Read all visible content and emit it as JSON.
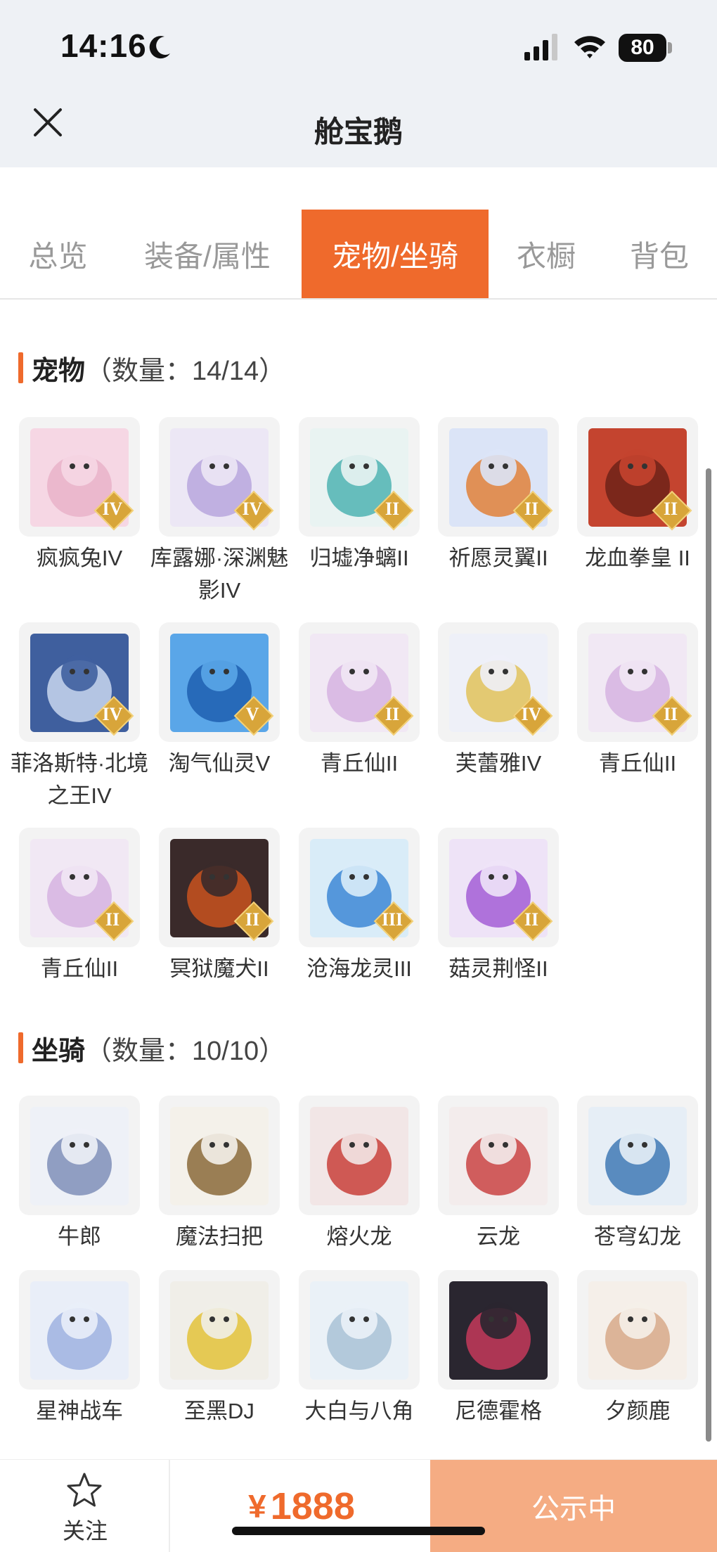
{
  "status_bar": {
    "time": "14:16",
    "battery": "80"
  },
  "nav": {
    "title": "舱宝鹅"
  },
  "tabs": [
    {
      "label": "总览",
      "active": false
    },
    {
      "label": "装备/属性",
      "active": false
    },
    {
      "label": "宠物/坐骑",
      "active": true
    },
    {
      "label": "衣橱",
      "active": false
    },
    {
      "label": "背包",
      "active": false
    }
  ],
  "pets": {
    "title": "宠物",
    "count": "（数量：14/14）",
    "items": [
      {
        "name": "疯疯兔IV",
        "rank": "IV",
        "icon": "pink-rabbit",
        "colors": [
          "#f6d7e4",
          "#e9b3c9"
        ]
      },
      {
        "name": "库露娜·深渊魅影IV",
        "rank": "IV",
        "icon": "white-haired-girl",
        "colors": [
          "#ece7f5",
          "#b8a6dd"
        ]
      },
      {
        "name": "归墟净螭II",
        "rank": "II",
        "icon": "jade-dragon",
        "colors": [
          "#e9f3f2",
          "#4fb3b3"
        ]
      },
      {
        "name": "祈愿灵翼II",
        "rank": "II",
        "icon": "winged-eagle",
        "colors": [
          "#dbe4f7",
          "#e0813a"
        ]
      },
      {
        "name": "龙血拳皇 II",
        "rank": "II",
        "icon": "red-dragon-boxer",
        "colors": [
          "#c4442f",
          "#6e2218"
        ]
      },
      {
        "name": "菲洛斯特·北境之王IV",
        "rank": "IV",
        "icon": "frost-wolf-king",
        "colors": [
          "#3f5f9e",
          "#c9d7ee"
        ]
      },
      {
        "name": "淘气仙灵V",
        "rank": "V",
        "icon": "blue-puppy",
        "colors": [
          "#5aa6e8",
          "#1f5fb0"
        ]
      },
      {
        "name": "青丘仙II",
        "rank": "II",
        "icon": "fox-spirit",
        "colors": [
          "#f1e8f4",
          "#d6b3e0"
        ]
      },
      {
        "name": "芙蕾雅IV",
        "rank": "IV",
        "icon": "valkyrie",
        "colors": [
          "#eef0f8",
          "#e0c25a"
        ]
      },
      {
        "name": "青丘仙II",
        "rank": "II",
        "icon": "fox-spirit",
        "colors": [
          "#f1e8f4",
          "#d6b3e0"
        ]
      },
      {
        "name": "青丘仙II",
        "rank": "II",
        "icon": "fox-spirit",
        "colors": [
          "#f1e8f4",
          "#d6b3e0"
        ]
      },
      {
        "name": "冥狱魔犬II",
        "rank": "II",
        "icon": "hell-hound",
        "colors": [
          "#3a2a2a",
          "#c9521f"
        ]
      },
      {
        "name": "沧海龙灵III",
        "rank": "III",
        "icon": "sea-dragon-girl",
        "colors": [
          "#d9ecf8",
          "#3d88d6"
        ]
      },
      {
        "name": "菇灵荆怪II",
        "rank": "II",
        "icon": "mushroom-sprite",
        "colors": [
          "#eee3f7",
          "#a35ed6"
        ]
      }
    ]
  },
  "mounts": {
    "title": "坐骑",
    "count": "（数量：10/10）",
    "items": [
      {
        "name": "牛郎",
        "icon": "ox-mount",
        "colors": [
          "#eef1f7",
          "#7f8fb8"
        ]
      },
      {
        "name": "魔法扫把",
        "icon": "magic-broom",
        "colors": [
          "#f4f1ea",
          "#8a6a3a"
        ]
      },
      {
        "name": "熔火龙",
        "icon": "lava-dragon",
        "colors": [
          "#f2e6e6",
          "#c9403a"
        ]
      },
      {
        "name": "云龙",
        "icon": "cloud-dragon",
        "colors": [
          "#f3ecec",
          "#c94444"
        ]
      },
      {
        "name": "苍穹幻龙",
        "icon": "sky-dragon",
        "colors": [
          "#e6eef6",
          "#3f79b5"
        ]
      },
      {
        "name": "星神战车",
        "icon": "star-chariot",
        "colors": [
          "#e9eef8",
          "#9fb2e0"
        ]
      },
      {
        "name": "至黑DJ",
        "icon": "dj-helmet",
        "colors": [
          "#f0eee8",
          "#e3c23a"
        ]
      },
      {
        "name": "大白与八角",
        "icon": "white-whale",
        "colors": [
          "#eaf1f7",
          "#a9c2d6"
        ]
      },
      {
        "name": "尼德霍格",
        "icon": "black-dragon",
        "colors": [
          "#2a2630",
          "#c4395a"
        ]
      },
      {
        "name": "夕颜鹿",
        "icon": "blossom-deer",
        "colors": [
          "#f5efe9",
          "#d7a98a"
        ]
      }
    ]
  },
  "bottom": {
    "follow_label": "关注",
    "currency": "¥",
    "price": "1888",
    "status_label": "公示中"
  },
  "colors": {
    "accent": "#ef6a2c",
    "status_button": "#f5ac83"
  }
}
